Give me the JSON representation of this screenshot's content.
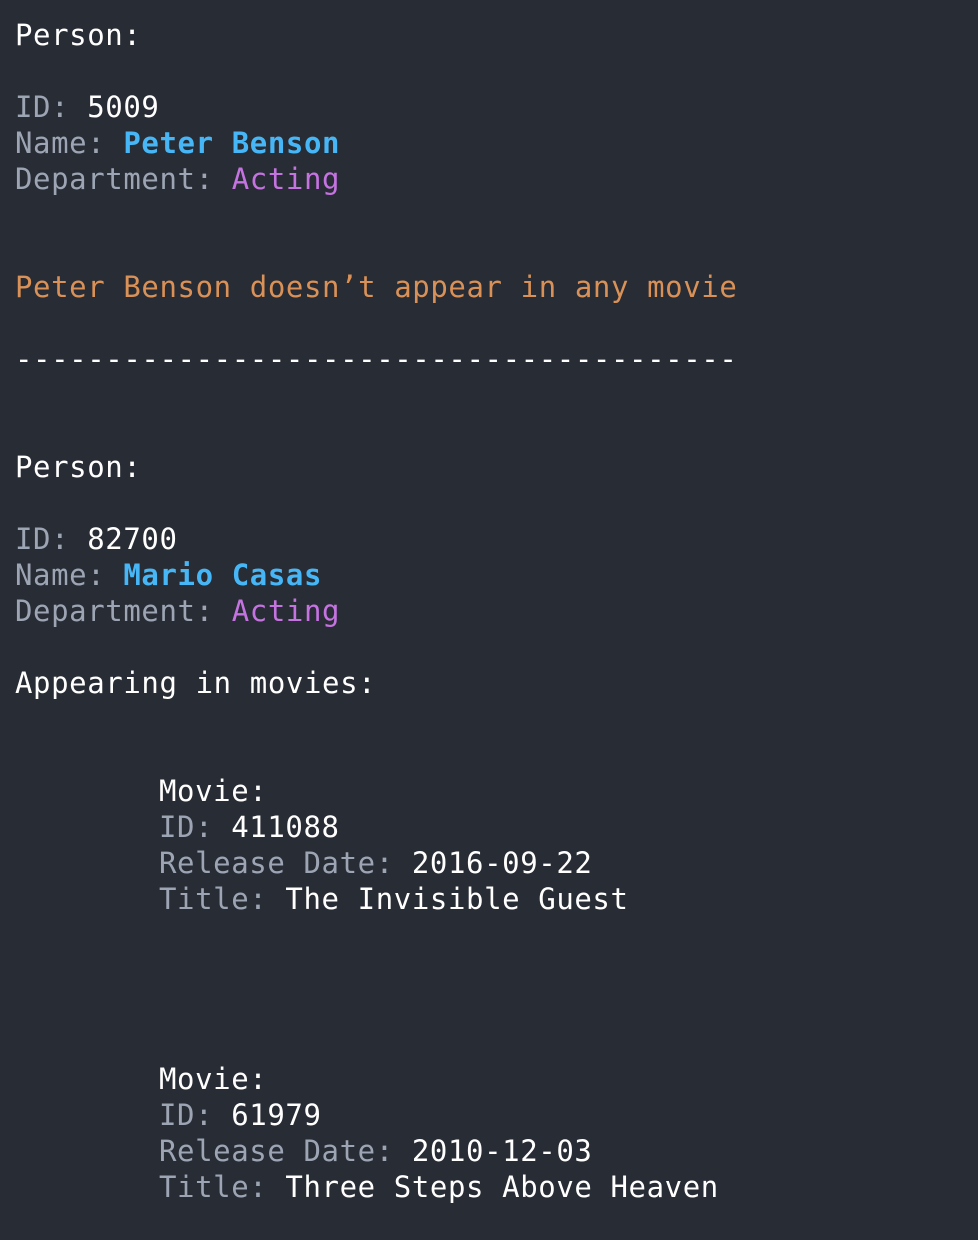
{
  "persons": [
    {
      "header": "Person:",
      "id_key": "ID: ",
      "id_value": "5009",
      "name_key": "Name: ",
      "name_value": "Peter Benson",
      "dept_key": "Department: ",
      "dept_value": "Acting",
      "message": "Peter Benson doesn’t appear in any movie"
    },
    {
      "header": "Person:",
      "id_key": "ID: ",
      "id_value": "82700",
      "name_key": "Name: ",
      "name_value": "Mario Casas",
      "dept_key": "Department: ",
      "dept_value": "Acting",
      "appearing_label": "Appearing in movies:",
      "movies": [
        {
          "header": "Movie:",
          "id_key": "ID: ",
          "id_value": "411088",
          "release_key": "Release Date: ",
          "release_value": "2016-09-22",
          "title_key": "Title: ",
          "title_value": "The Invisible Guest"
        },
        {
          "header": "Movie:",
          "id_key": "ID: ",
          "id_value": "61979",
          "release_key": "Release Date: ",
          "release_value": "2010-12-03",
          "title_key": "Title: ",
          "title_value": "Three Steps Above Heaven"
        }
      ]
    }
  ],
  "separator": "----------------------------------------",
  "colors": {
    "background": "#282c34",
    "key": "#9da5b4",
    "value": "#ffffff",
    "name": "#46b6f7",
    "department": "#c473e0",
    "message": "#d99157"
  }
}
